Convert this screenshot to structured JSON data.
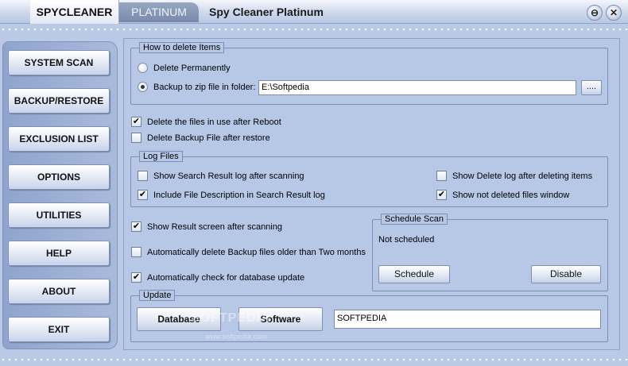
{
  "titlebar": {
    "brand": "SPYCLEANER",
    "edition": "PLATINUM",
    "title": "Spy Cleaner Platinum",
    "minimize_glyph": "⊖",
    "close_glyph": "✕"
  },
  "sidebar": {
    "items": [
      {
        "label": "SYSTEM SCAN"
      },
      {
        "label": "BACKUP/RESTORE"
      },
      {
        "label": "EXCLUSION LIST"
      },
      {
        "label": "OPTIONS"
      },
      {
        "label": "UTILITIES"
      },
      {
        "label": "HELP"
      },
      {
        "label": "ABOUT"
      },
      {
        "label": "EXIT"
      }
    ]
  },
  "delete_items": {
    "title": "How to delete Items",
    "option_permanent": {
      "label": "Delete Permanently",
      "selected": false
    },
    "option_backup": {
      "label": "Backup to zip file in folder:",
      "selected": true
    },
    "folder_value": "E:\\Softpedia",
    "browse_label": "...."
  },
  "general": {
    "delete_in_use": {
      "label": "Delete the files in use after Reboot",
      "checked": true
    },
    "delete_backup": {
      "label": "Delete Backup File after restore",
      "checked": false
    }
  },
  "log_files": {
    "title": "Log Files",
    "show_search_log": {
      "label": "Show Search Result log after scanning",
      "checked": false
    },
    "include_description": {
      "label": "Include File Description in Search Result log",
      "checked": true
    },
    "show_delete_log": {
      "label": "Show Delete log after deleting items",
      "checked": false
    },
    "show_not_deleted": {
      "label": "Show not deleted files window",
      "checked": true
    }
  },
  "options": {
    "show_result_screen": {
      "label": "Show Result screen after scanning",
      "checked": true
    },
    "auto_delete_backup": {
      "label": "Automatically delete Backup files older than Two months",
      "checked": false
    },
    "auto_check_update": {
      "label": "Automatically check for database update",
      "checked": true
    }
  },
  "schedule": {
    "title": "Schedule Scan",
    "status": "Not scheduled",
    "schedule_label": "Schedule",
    "disable_label": "Disable"
  },
  "update": {
    "title": "Update",
    "database_label": "Database",
    "software_label": "Software",
    "field_value": "SOFTPEDIA"
  },
  "watermark": {
    "text": "SOFTPEDIA",
    "url": "www.softpedia.com"
  },
  "check_glyph": "✔"
}
